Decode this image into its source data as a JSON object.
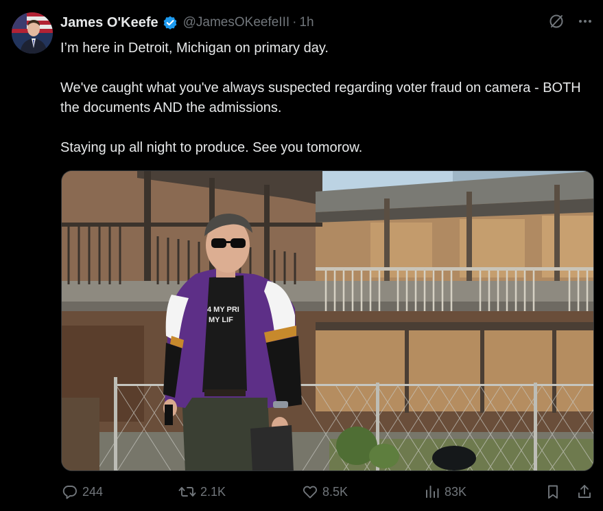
{
  "author": {
    "display_name": "James O'Keefe",
    "handle": "@JamesOKeefeIII",
    "separator": "·",
    "time": "1h",
    "verified_color": "#1d9bf0"
  },
  "tweet": {
    "lines": [
      "I’m here in Detroit, Michigan on primary day.",
      "We've caught what you've always suspected regarding voter fraud on camera - BOTH the documents AND the admissions.",
      "Staying up all night to produce. See you tomorow."
    ],
    "media_shirt_text": "4 MY PRI",
    "media_shirt_text_2": "MY LIF"
  },
  "header_icons": [
    "grok-icon",
    "more-icon"
  ],
  "actions": {
    "replies": "244",
    "reposts": "2.1K",
    "likes": "8.5K",
    "views": "83K"
  },
  "colors": {
    "background": "#000000",
    "text": "#e7e9ea",
    "muted": "#71767b",
    "accent": "#1d9bf0"
  }
}
